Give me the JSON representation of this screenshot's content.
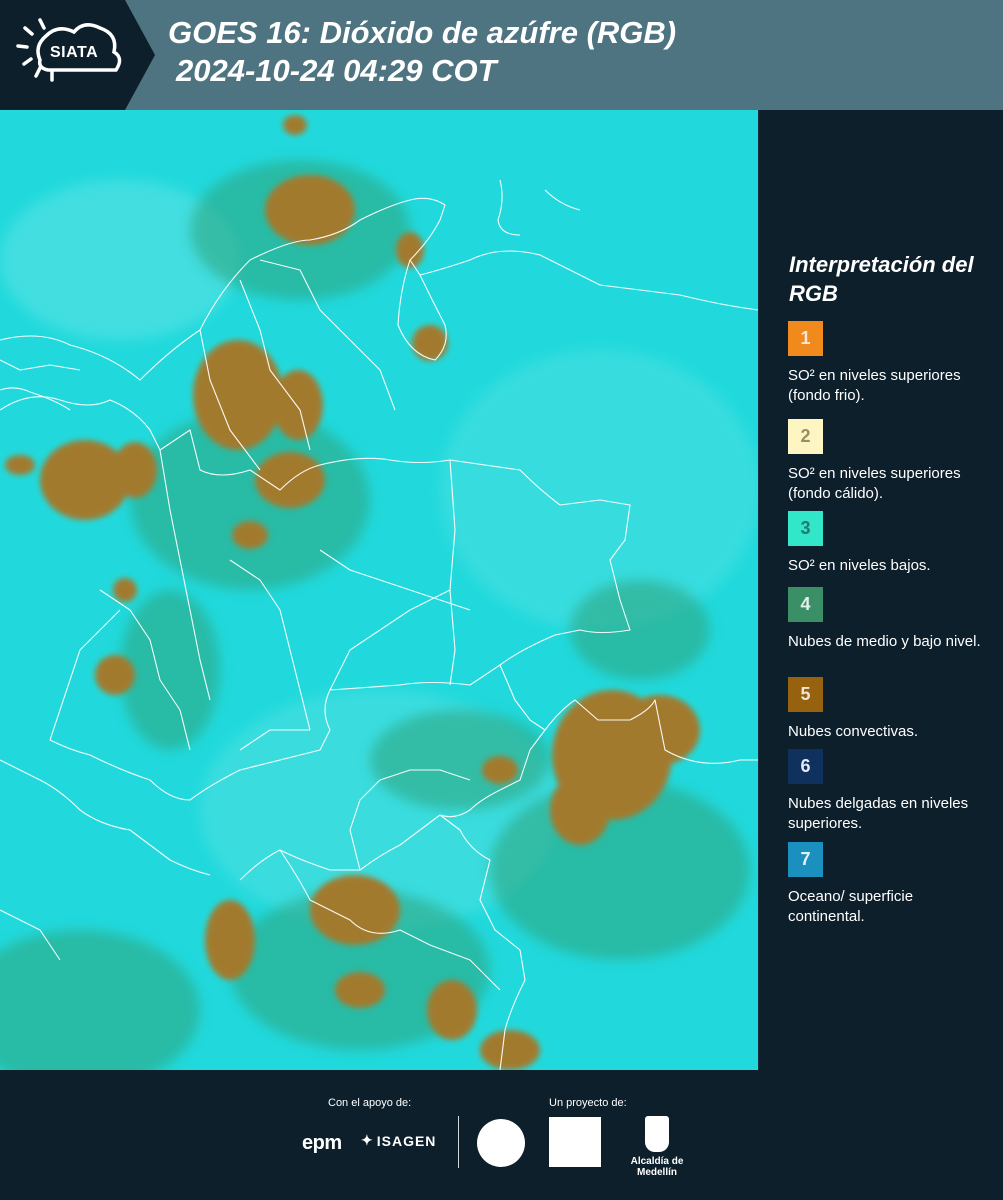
{
  "header": {
    "logo_text": "SIATA",
    "title_line1": "GOES 16: Dióxido de azúfre (RGB)",
    "title_line2": "2024-10-24 04:29 COT"
  },
  "legend": {
    "title": "Interpretación del RGB",
    "items": [
      {
        "number": "1",
        "color": "#f08a1d",
        "text_color": "#f6e7da",
        "label": "SO² en niveles superiores (fondo frio)."
      },
      {
        "number": "2",
        "color": "#fdf5c2",
        "text_color": "#9b8e63",
        "label": "SO² en niveles superiores (fondo cálido)."
      },
      {
        "number": "3",
        "color": "#31e6c9",
        "text_color": "#1c7d6e",
        "label": "SO² en niveles bajos."
      },
      {
        "number": "4",
        "color": "#3b8f66",
        "text_color": "#e2f1e8",
        "label": "Nubes de medio y bajo nivel."
      },
      {
        "number": "5",
        "color": "#96620f",
        "text_color": "#f2e4cf",
        "label": "Nubes convectivas."
      },
      {
        "number": "6",
        "color": "#10305e",
        "text_color": "#e4ebf4",
        "label": "Nubes delgadas en niveles superiores."
      },
      {
        "number": "7",
        "color": "#1b8fbd",
        "text_color": "#e3f3fa",
        "label": "Oceano/ superficie continental."
      }
    ]
  },
  "footer": {
    "support_label": "Con el apoyo de:",
    "project_label": "Un proyecto de:",
    "epm": "epm",
    "isagen": "ISAGEN",
    "alcaldia": "Alcaldía de Medellín"
  },
  "map": {
    "background_color": "#21d9dc",
    "cloud_color": "#a27a2e",
    "border_color": "#ffffff"
  }
}
